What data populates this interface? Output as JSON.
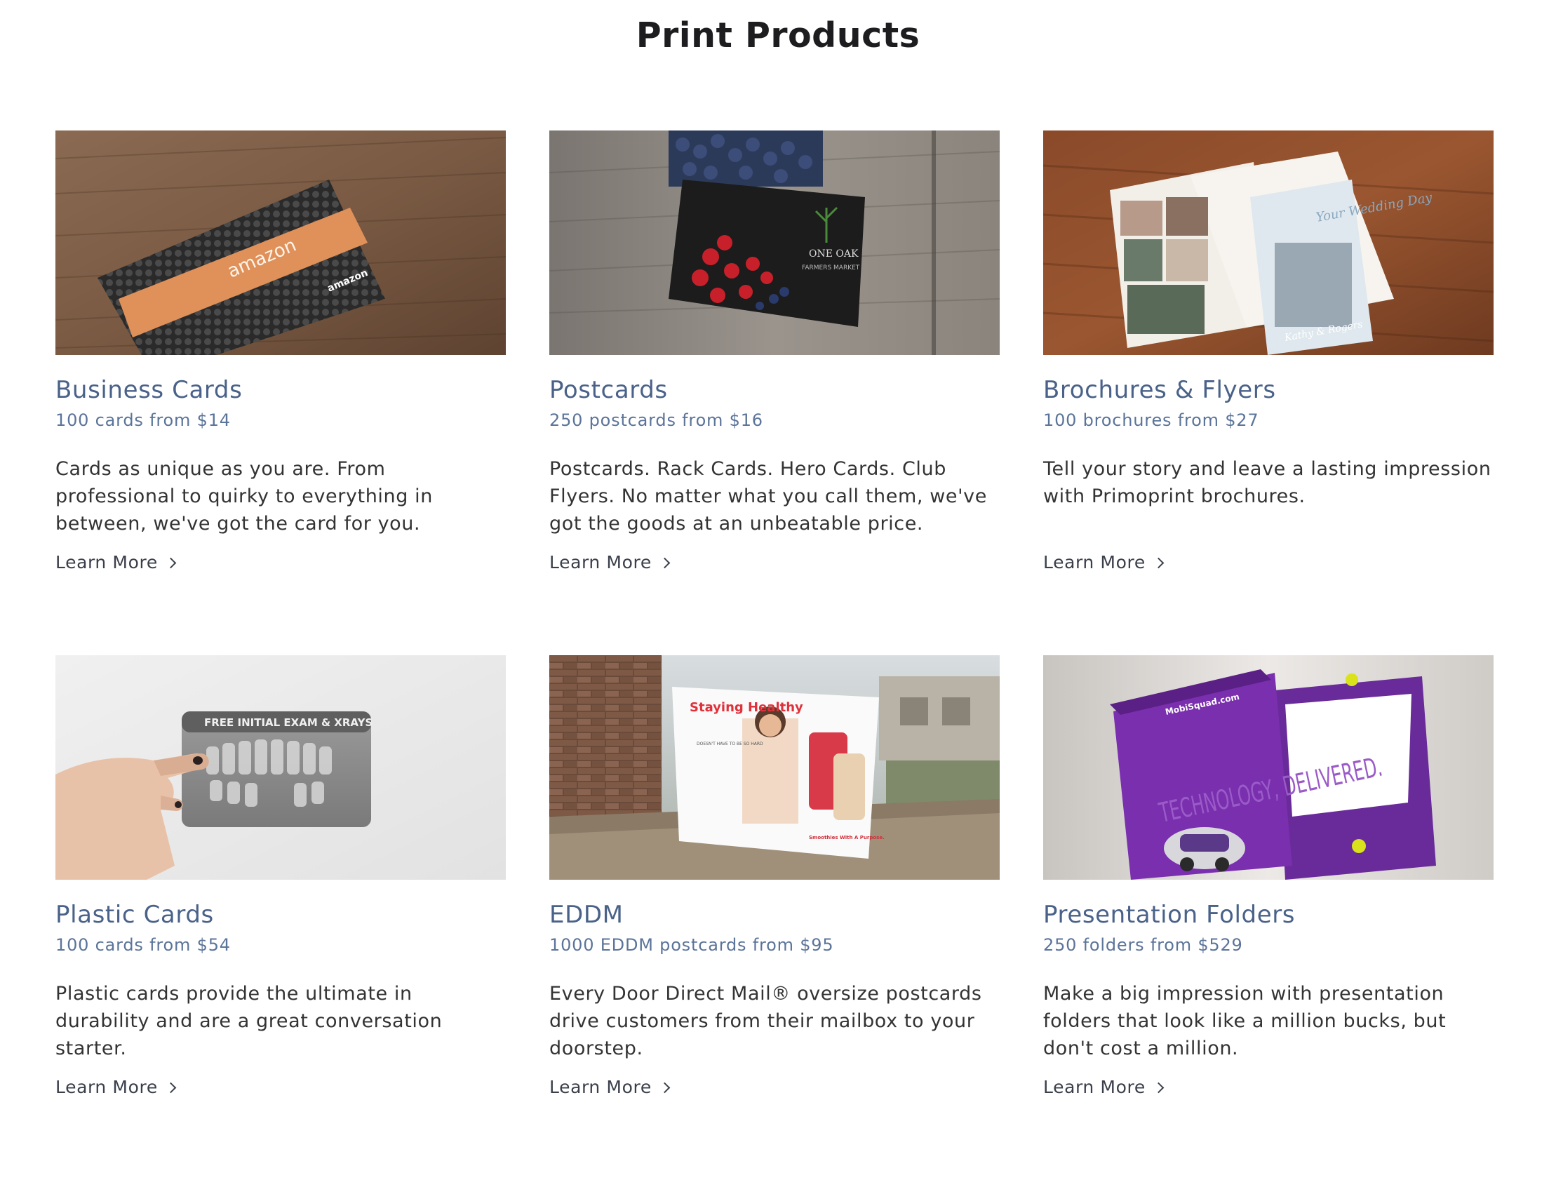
{
  "page": {
    "title": "Print Products"
  },
  "products": [
    {
      "title": "Business Cards",
      "price": "100 cards from $14",
      "description": "Cards as unique as you are. From professional to quirky to everything in between, we've got the card for you.",
      "link": "Learn More",
      "image": "business-cards-photo"
    },
    {
      "title": "Postcards",
      "price": "250 postcards from $16",
      "description": "Postcards. Rack Cards. Hero Cards. Club Flyers. No matter what you call them, we've got the goods at an unbeatable price.",
      "link": "Learn More",
      "image": "postcards-photo"
    },
    {
      "title": "Brochures & Flyers",
      "price": "100 brochures from $27",
      "description": "Tell your story and leave a lasting impression with Primoprint brochures.",
      "link": "Learn More",
      "image": "brochures-photo"
    },
    {
      "title": "Plastic Cards",
      "price": "100 cards from $54",
      "description": "Plastic cards provide the ultimate in durability and are a great conversation starter.",
      "link": "Learn More",
      "image": "plastic-cards-photo"
    },
    {
      "title": "EDDM",
      "price": "1000 EDDM postcards from $95",
      "description": "Every Door Direct Mail® oversize postcards drive customers from their mailbox to your doorstep.",
      "link": "Learn More",
      "image": "eddm-photo"
    },
    {
      "title": "Presentation Folders",
      "price": "250 folders from $529",
      "description": "Make a big impression with presentation folders that look like a million bucks, but don't cost a million.",
      "link": "Learn More",
      "image": "presentation-folders-photo"
    }
  ],
  "image_text": {
    "business_card_brand": "amazon",
    "business_card_brand2": "amazon",
    "postcard_brand": "ONE OAK",
    "postcard_sub": "FARMERS MARKET",
    "brochure_heading": "Your Wedding Day",
    "brochure_names": "Kathy & Rogers",
    "plastic_card_heading": "FREE INITIAL EXAM & XRAYS",
    "eddm_heading": "Staying Healthy",
    "eddm_sub": "DOESN'T HAVE TO BE SO HARD",
    "eddm_brand": "Smoothies With A Purpose.",
    "folder_brand": "MobiSquad.com",
    "folder_slogan": "TECHNOLOGY, DELIVERED."
  },
  "colors": {
    "title": "#1d1d1f",
    "product_title": "#4a6289",
    "product_price": "#5b7499",
    "body_text": "#333333",
    "link_text": "#3a3f4a"
  }
}
